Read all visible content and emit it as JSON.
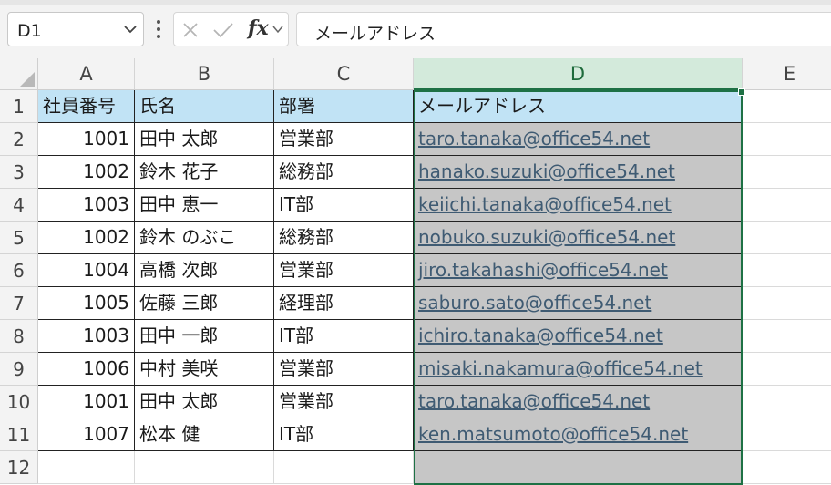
{
  "formula_bar": {
    "name_box": "D1",
    "content": "メールアドレス",
    "fx_label": "fx"
  },
  "columns": [
    "A",
    "B",
    "C",
    "D",
    "E"
  ],
  "rows": [
    "1",
    "2",
    "3",
    "4",
    "5",
    "6",
    "7",
    "8",
    "9",
    "10",
    "11",
    "12"
  ],
  "sheet": {
    "header": [
      "社員番号",
      "氏名",
      "部署",
      "メールアドレス"
    ],
    "records": [
      [
        "1001",
        "田中 太郎",
        "営業部",
        "taro.tanaka@office54.net"
      ],
      [
        "1002",
        "鈴木 花子",
        "総務部",
        "hanako.suzuki@office54.net"
      ],
      [
        "1003",
        "田中 恵一",
        "IT部",
        "keiichi.tanaka@office54.net"
      ],
      [
        "1002",
        "鈴木 のぶこ",
        "総務部",
        "nobuko.suzuki@office54.net"
      ],
      [
        "1004",
        "高橋 次郎",
        "営業部",
        "jiro.takahashi@office54.net"
      ],
      [
        "1005",
        "佐藤 三郎",
        "経理部",
        "saburo.sato@office54.net"
      ],
      [
        "1003",
        "田中 一郎",
        "IT部",
        "ichiro.tanaka@office54.net"
      ],
      [
        "1006",
        "中村 美咲",
        "営業部",
        "misaki.nakamura@office54.net"
      ],
      [
        "1001",
        "田中 太郎",
        "営業部",
        "taro.tanaka@office54.net"
      ],
      [
        "1007",
        "松本 健",
        "IT部",
        "ken.matsumoto@office54.net"
      ]
    ]
  },
  "colors": {
    "header_fill": "#c1e3f5",
    "selection": "#1e7145",
    "selected_range_fill": "#c6c6c6",
    "link_text": "#3f5b73"
  },
  "selection": {
    "active_cell": "D1",
    "range": "D1:D12"
  }
}
